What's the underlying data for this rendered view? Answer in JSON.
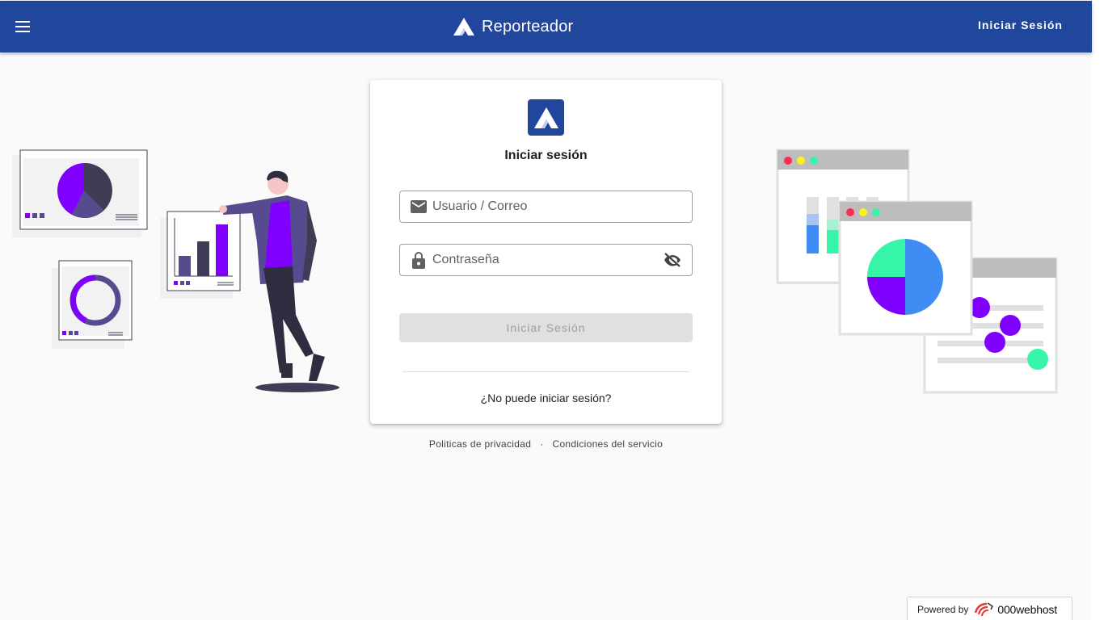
{
  "app": {
    "title": "Reporteador",
    "header_login": "Iniciar Sesión",
    "menu_icon": "menu-icon",
    "logo_icon": "app-logo-icon",
    "brand_color": "#21479c"
  },
  "login_card": {
    "title": "Iniciar sesión",
    "username": {
      "placeholder": "Usuario / Correo",
      "value": "",
      "icon": "mail-icon"
    },
    "password": {
      "placeholder": "Contraseña",
      "value": "",
      "icon": "lock-icon",
      "toggle_icon": "eye-off-icon"
    },
    "submit_label": "Iniciar Sesión",
    "submit_disabled": true,
    "forgot_label": "¿No puede iniciar sesión?"
  },
  "footer": {
    "privacy": "Politicas de privacidad",
    "separator": "·",
    "terms": "Condiciones del servicio"
  },
  "powered_badge": {
    "prefix": "Powered by",
    "brand": "000webhost"
  },
  "colors": {
    "accent_purple": "#8000ff",
    "dark_purple": "#3f3d56",
    "mid_purple": "#574b90",
    "teal": "#36f5a8",
    "blue": "#3f8cf5",
    "red_dot": "#ff2b56",
    "yellow_dot": "#f8f31b",
    "green_dot": "#36f5a8"
  }
}
